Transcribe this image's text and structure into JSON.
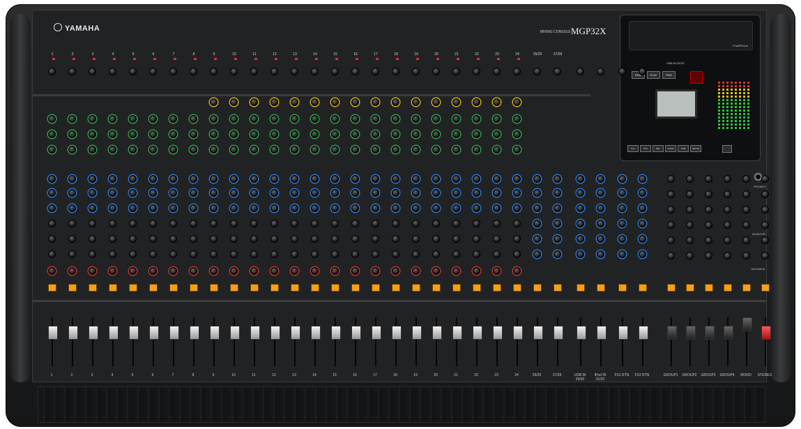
{
  "brand": "YAMAHA",
  "model_caption": "MIXING CONSOLE",
  "model": "MGP32X",
  "channels": [
    "1",
    "2",
    "3",
    "4",
    "5",
    "6",
    "7",
    "8",
    "9",
    "10",
    "11",
    "12",
    "13",
    "14",
    "15",
    "16",
    "17",
    "18",
    "19",
    "20",
    "21",
    "22",
    "23",
    "24"
  ],
  "stereo_channels": [
    "25/26",
    "27/28",
    "29/30",
    "31/32"
  ],
  "bottom_labels": [
    "1",
    "2",
    "3",
    "4",
    "5",
    "6",
    "7",
    "8",
    "9",
    "10",
    "11",
    "12",
    "13",
    "14",
    "15",
    "16",
    "17",
    "18",
    "19",
    "20",
    "21",
    "22",
    "23",
    "24",
    "25/26",
    "27/28",
    "USB IN 29/30",
    "iPod IN 31/32",
    "FX1 RTN",
    "FX2 RTN",
    "GROUP1",
    "GROUP2",
    "GROUP3",
    "GROUP4",
    "MONO",
    "STEREO"
  ],
  "usb_section": {
    "usb_access": "USB ACCESS",
    "transport": [
      "REW",
      "PLAY",
      "FWD"
    ],
    "ipod_label": "iPod/iPhone",
    "fx_buttons": [
      "FX1",
      "FX2",
      "DEL",
      "COMP",
      "USB",
      "SETUP"
    ]
  },
  "master_labels": {
    "phones": "PHONES",
    "monitor": "MONITOR",
    "talkback": "TALKBACK"
  },
  "colors": {
    "on_button": "#f2a01a",
    "eq_green": "#2fa84a",
    "eq_blue": "#2d7ad6",
    "comp_yellow": "#d7b21c",
    "stereo_fader": "#ff5a5a"
  }
}
